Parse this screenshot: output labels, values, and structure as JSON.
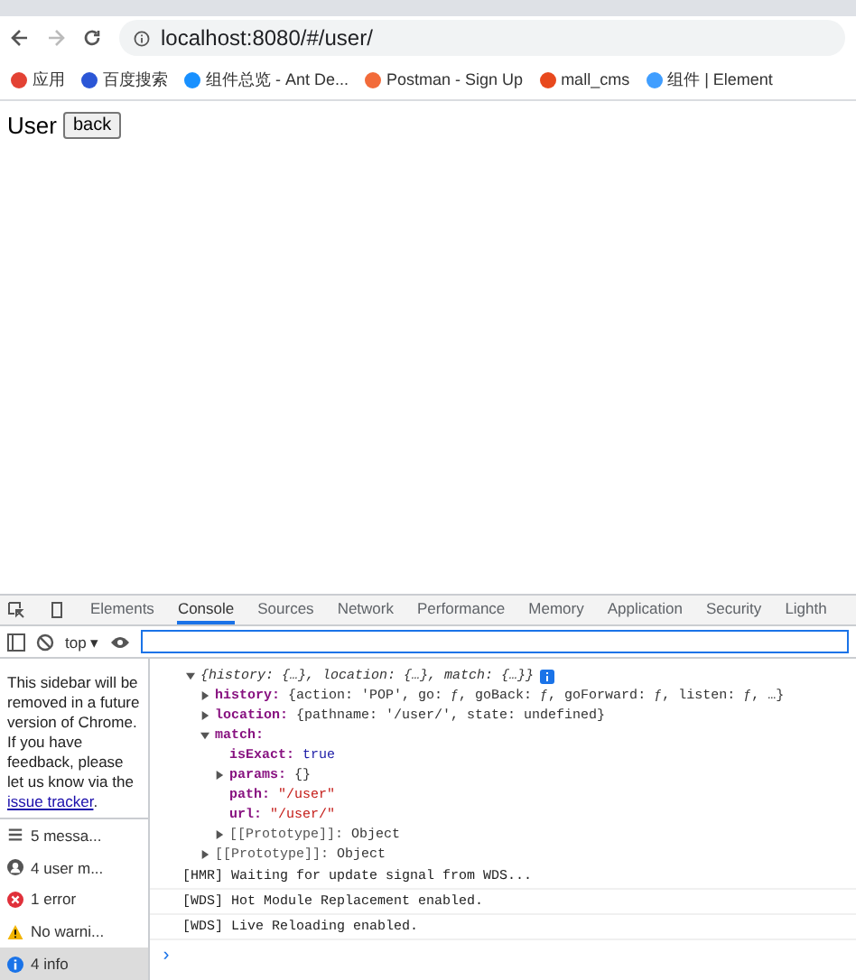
{
  "browser": {
    "address": "localhost:8080/#/user/",
    "bookmarks": [
      {
        "label": "应用",
        "color": "#e34234"
      },
      {
        "label": "百度搜索",
        "color": "#2b56d6"
      },
      {
        "label": "组件总览 - Ant De...",
        "color": "#1890ff"
      },
      {
        "label": "Postman - Sign Up",
        "color": "#f26b3a"
      },
      {
        "label": "mall_cms",
        "color": "#e8491d"
      },
      {
        "label": "组件 | Element",
        "color": "#409eff"
      }
    ]
  },
  "page": {
    "heading": "User",
    "button": "back"
  },
  "devtools": {
    "tabs": [
      {
        "label": "Elements",
        "selected": false
      },
      {
        "label": "Console",
        "selected": true
      },
      {
        "label": "Sources",
        "selected": false
      },
      {
        "label": "Network",
        "selected": false
      },
      {
        "label": "Performance",
        "selected": false
      },
      {
        "label": "Memory",
        "selected": false
      },
      {
        "label": "Application",
        "selected": false
      },
      {
        "label": "Security",
        "selected": false
      },
      {
        "label": "Lighth",
        "selected": false
      }
    ],
    "context": "top ▾",
    "sidebar": {
      "notice": "This sidebar will be removed in a future version of Chrome. If you have feedback, please let us know via the",
      "link": "issue tracker",
      "after_link": ".",
      "items": [
        {
          "kind": "messages",
          "label": "5 messa...",
          "selected": false
        },
        {
          "kind": "user",
          "label": "4 user m...",
          "selected": false
        },
        {
          "kind": "error",
          "label": "1 error",
          "selected": false
        },
        {
          "kind": "warning",
          "label": "No warni...",
          "selected": false
        },
        {
          "kind": "info",
          "label": "4 info",
          "selected": true
        }
      ]
    },
    "console": [
      {
        "kind": "object",
        "summary": "{history: {…}, location: {…}, match: {…}}",
        "expanded": true,
        "children": [
          {
            "key": "history:",
            "value": "{action: 'POP', go: ƒ, goBack: ƒ, goForward: ƒ, listen: ƒ, …}",
            "kind": "object",
            "expanded": false
          },
          {
            "key": "location:",
            "value": "{pathname: '/user/', state: undefined}",
            "kind": "object",
            "expanded": false
          },
          {
            "key": "match:",
            "kind": "object",
            "expanded": true,
            "children": [
              {
                "key": "isExact:",
                "value": "true",
                "kind": "boolean"
              },
              {
                "key": "params:",
                "value": "{}",
                "kind": "object",
                "expanded": false
              },
              {
                "key": "path:",
                "value": "\"/user\"",
                "kind": "string"
              },
              {
                "key": "url:",
                "value": "\"/user/\"",
                "kind": "string"
              },
              {
                "key": "[[Prototype]]:",
                "value": "Object",
                "kind": "internal",
                "expanded": false
              }
            ]
          },
          {
            "key": "[[Prototype]]:",
            "value": "Object",
            "kind": "internal",
            "expanded": false
          }
        ]
      },
      {
        "kind": "log",
        "text": "[HMR] Waiting for update signal from WDS..."
      },
      {
        "kind": "log",
        "text": "[WDS] Hot Module Replacement enabled."
      },
      {
        "kind": "log",
        "text": "[WDS] Live Reloading enabled."
      }
    ],
    "prompt": "›"
  }
}
